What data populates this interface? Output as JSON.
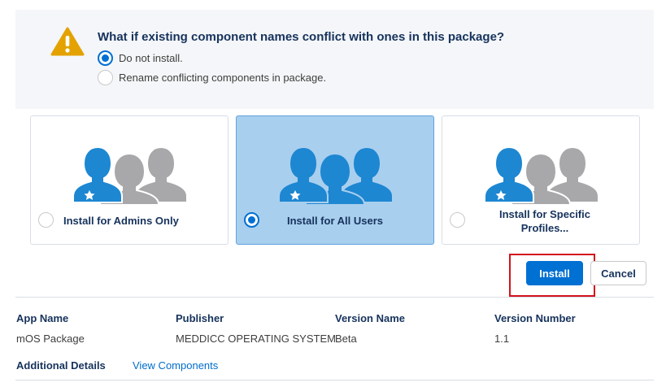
{
  "conflict": {
    "question": "What if existing component names conflict with ones in this package?",
    "options": [
      {
        "label": "Do not install.",
        "selected": true
      },
      {
        "label": "Rename conflicting components in package.",
        "selected": false
      }
    ]
  },
  "install_options": [
    {
      "label": "Install for Admins Only",
      "selected": false,
      "icon": "admins-users-icon"
    },
    {
      "label": "Install for All Users",
      "selected": true,
      "icon": "all-users-icon"
    },
    {
      "label": "Install for Specific Profiles...",
      "selected": false,
      "icon": "specific-profiles-icon"
    }
  ],
  "buttons": {
    "install": "Install",
    "cancel": "Cancel"
  },
  "package": {
    "headers": [
      "App Name",
      "Publisher",
      "Version Name",
      "Version Number"
    ],
    "values": [
      "mOS Package",
      "MEDDICC OPERATING SYSTEM",
      "Beta",
      "1.1"
    ]
  },
  "details": {
    "label": "Additional Details",
    "link": "View Components"
  },
  "colors": {
    "accent": "#0070d2",
    "selected_card": "#a9cfee",
    "person_blue": "#1d87d2",
    "person_gray": "#a8a8ab",
    "highlight_border": "#d3131c",
    "warning": "#e4a201"
  }
}
